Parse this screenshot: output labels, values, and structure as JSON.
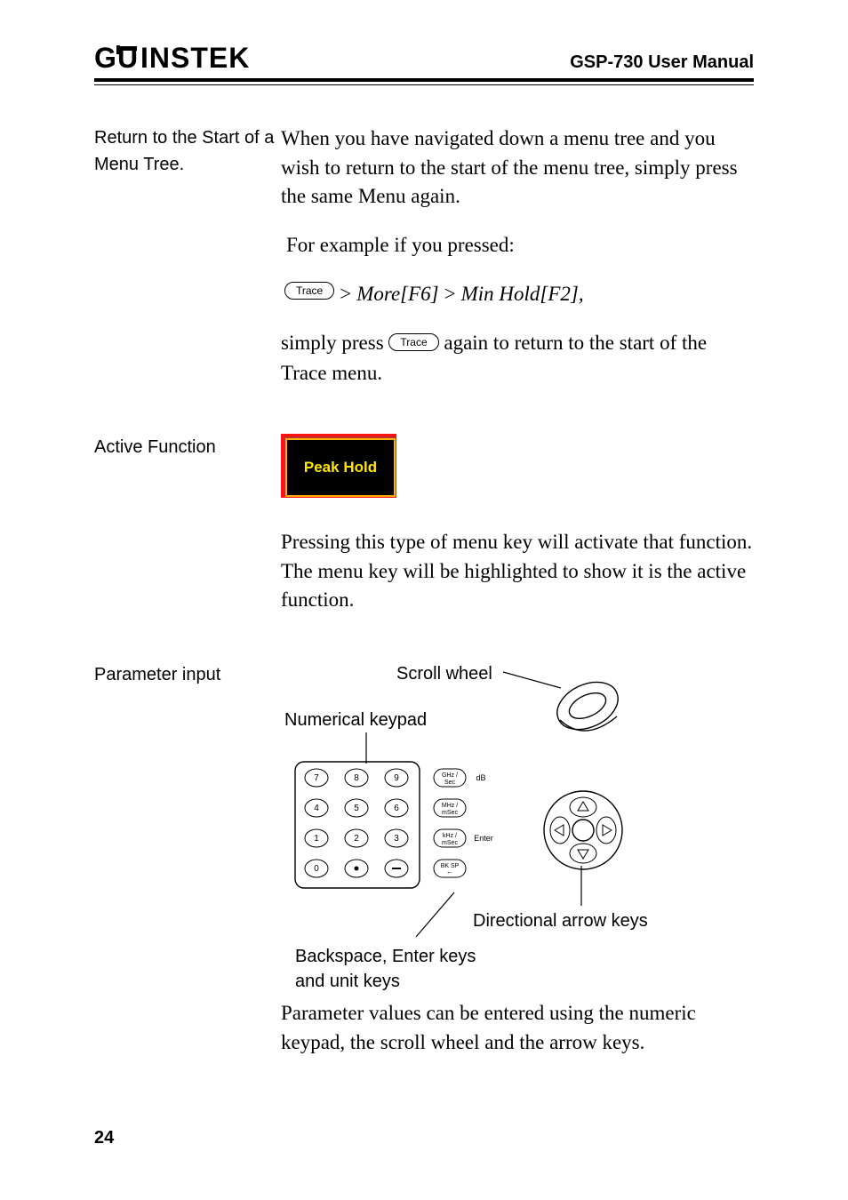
{
  "header": {
    "brand": "GWINSTEK",
    "doc_title": "GSP-730 User Manual"
  },
  "sections": {
    "return_menu": {
      "side": "Return to the Start of a Menu Tree.",
      "p1": "When you have navigated down a menu tree and you wish to return to the start of the menu tree, simply press the same Menu again.",
      "p2": "For example if you pressed:",
      "trace_label": "Trace",
      "seq1": "More[F6]",
      "seq2": "Min Hold[F2],",
      "gt": ">",
      "p3a": " simply press ",
      "p3b": " again to return to the start of the Trace menu."
    },
    "active_function": {
      "side": "Active Function",
      "box_text": "Peak Hold",
      "p1": "Pressing this type of menu key will activate that function. The menu key will be highlighted to show it is the active function."
    },
    "parameter_input": {
      "side": "Parameter input",
      "labels": {
        "scroll_wheel": "Scroll wheel",
        "numerical_keypad": "Numerical keypad",
        "directional": "Directional arrow keys",
        "backspace": "Backspace, Enter keys and unit keys"
      },
      "keypad": {
        "rows": [
          [
            "7",
            "8",
            "9"
          ],
          [
            "4",
            "5",
            "6"
          ],
          [
            "1",
            "2",
            "3"
          ],
          [
            "0",
            "○",
            "−"
          ]
        ],
        "units": [
          "GHz / Sec",
          "MHz / mSec",
          "kHz / mSec",
          "BK SP"
        ],
        "right_labels": [
          "dB",
          "",
          "Enter",
          ""
        ]
      },
      "p1": "Parameter values can be entered using the numeric keypad, the scroll wheel and the arrow keys."
    }
  },
  "page_number": "24"
}
